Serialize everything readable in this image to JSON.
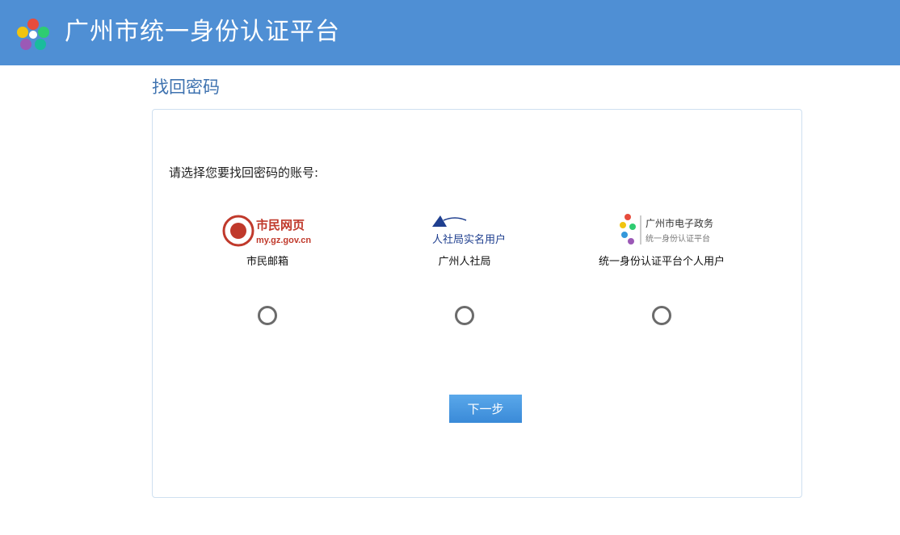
{
  "header": {
    "title": "广州市统一身份认证平台",
    "logo_icon": "flower-logo-icon",
    "background_color": "#4f8fd4"
  },
  "page": {
    "title": "找回密码"
  },
  "card": {
    "prompt": "请选择您要找回密码的账号:",
    "options": [
      {
        "logo_text_main": "市民网页",
        "logo_text_sub": "my.gz.gov.cn",
        "label": "市民邮箱",
        "selected": false
      },
      {
        "logo_text_main": "人社局实名用户",
        "label": "广州人社局",
        "selected": false
      },
      {
        "logo_text_main": "广州市电子政务",
        "logo_text_sub": "统一身份认证平台",
        "label": "统一身份认证平台个人用户",
        "selected": false
      }
    ],
    "next_button": "下一步"
  },
  "colors": {
    "accent": "#4f8fd4",
    "title_blue": "#3f73b0",
    "button_blue": "#4a9ae2",
    "citizen_red": "#c0392b"
  }
}
